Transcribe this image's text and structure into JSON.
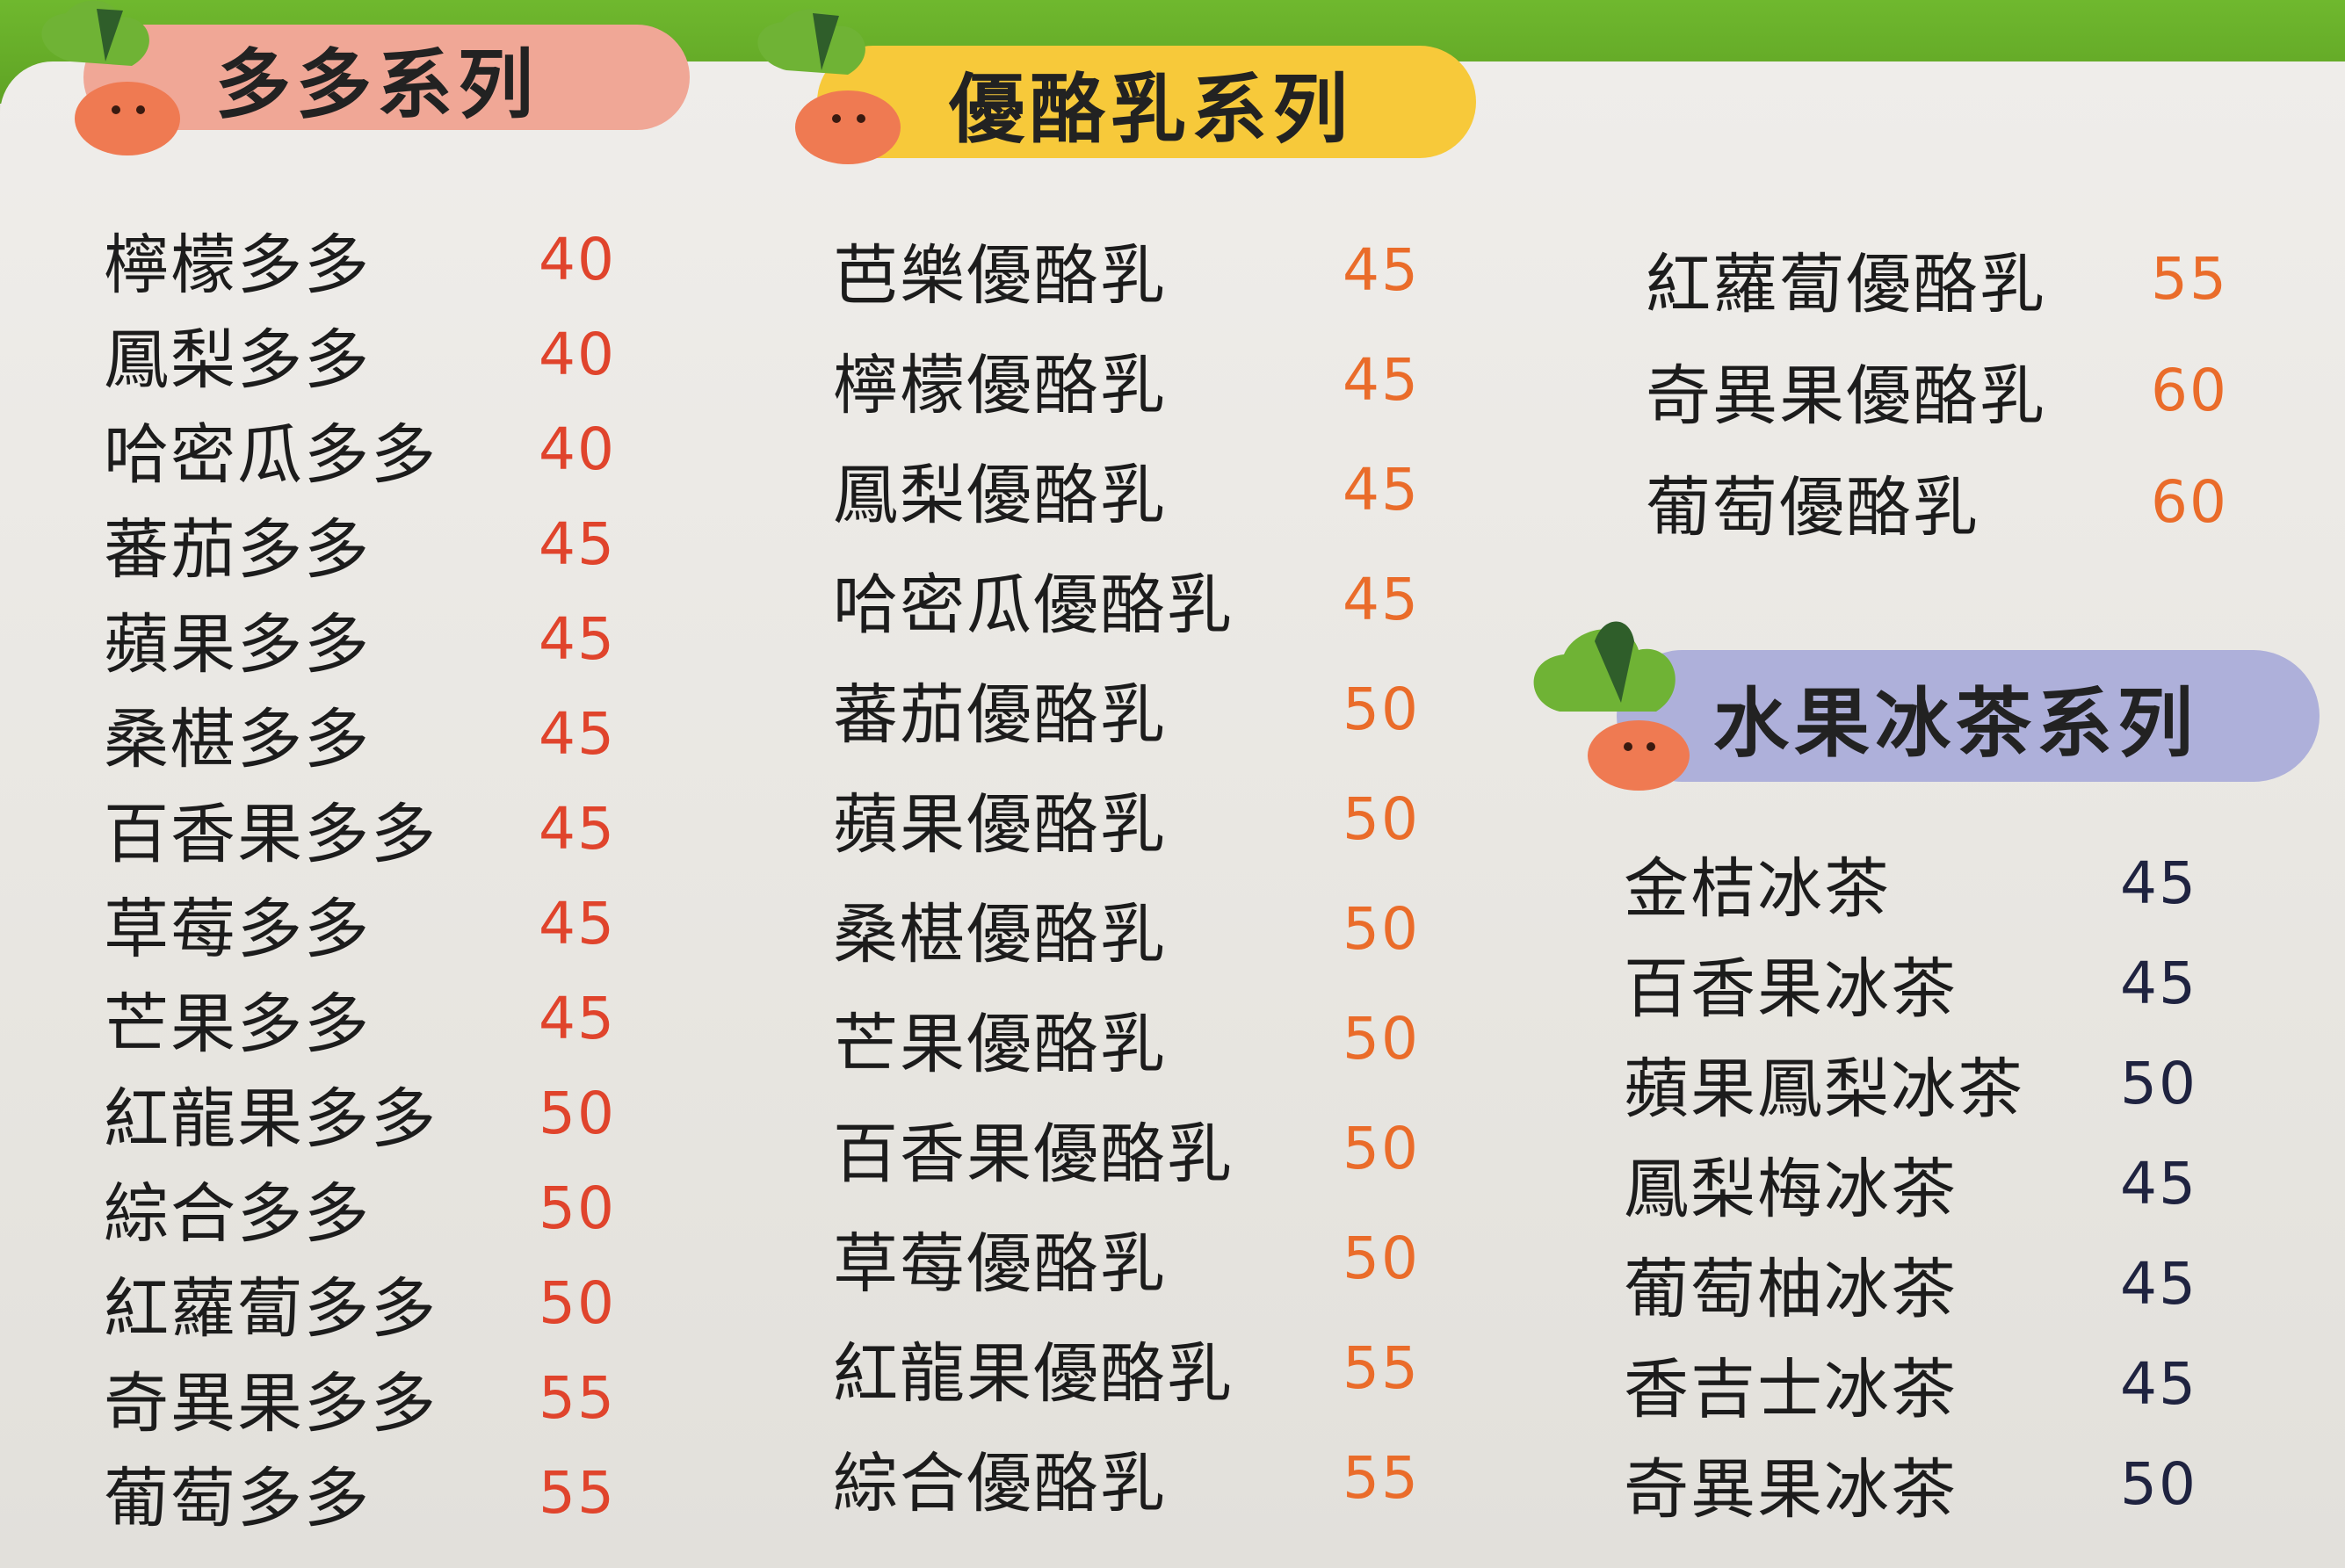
{
  "colors": {
    "green_band": "#66ad28",
    "duoduo_banner": "#f0a796",
    "yogurt_banner": "#f7c93a",
    "tea_banner": "#aeb0da",
    "price_red": "#e0442c",
    "price_orange": "#ea6c2a",
    "price_dark": "#1f2340",
    "mascot_leaf": "#6fb335",
    "mascot_body": "#ef7a52"
  },
  "sections": {
    "duoduo": {
      "title": "多多系列",
      "items": [
        {
          "name": "檸檬多多",
          "price": "40"
        },
        {
          "name": "鳳梨多多",
          "price": "40"
        },
        {
          "name": "哈密瓜多多",
          "price": "40"
        },
        {
          "name": "蕃茄多多",
          "price": "45"
        },
        {
          "name": "蘋果多多",
          "price": "45"
        },
        {
          "name": "桑椹多多",
          "price": "45"
        },
        {
          "name": "百香果多多",
          "price": "45"
        },
        {
          "name": "草莓多多",
          "price": "45"
        },
        {
          "name": "芒果多多",
          "price": "45"
        },
        {
          "name": "紅龍果多多",
          "price": "50"
        },
        {
          "name": "綜合多多",
          "price": "50"
        },
        {
          "name": "紅蘿蔔多多",
          "price": "50"
        },
        {
          "name": "奇異果多多",
          "price": "55"
        },
        {
          "name": "葡萄多多",
          "price": "55"
        }
      ]
    },
    "yogurt": {
      "title": "優酪乳系列",
      "items": [
        {
          "name": "芭樂優酪乳",
          "price": "45"
        },
        {
          "name": "檸檬優酪乳",
          "price": "45"
        },
        {
          "name": "鳳梨優酪乳",
          "price": "45"
        },
        {
          "name": "哈密瓜優酪乳",
          "price": "45"
        },
        {
          "name": "蕃茄優酪乳",
          "price": "50"
        },
        {
          "name": "蘋果優酪乳",
          "price": "50"
        },
        {
          "name": "桑椹優酪乳",
          "price": "50"
        },
        {
          "name": "芒果優酪乳",
          "price": "50"
        },
        {
          "name": "百香果優酪乳",
          "price": "50"
        },
        {
          "name": "草莓優酪乳",
          "price": "50"
        },
        {
          "name": "紅龍果優酪乳",
          "price": "55"
        },
        {
          "name": "綜合優酪乳",
          "price": "55"
        }
      ],
      "extra_items": [
        {
          "name": "紅蘿蔔優酪乳",
          "price": "55"
        },
        {
          "name": "奇異果優酪乳",
          "price": "60"
        },
        {
          "name": "葡萄優酪乳",
          "price": "60"
        }
      ]
    },
    "tea": {
      "title": "水果冰茶系列",
      "items": [
        {
          "name": "金桔冰茶",
          "price": "45"
        },
        {
          "name": "百香果冰茶",
          "price": "45"
        },
        {
          "name": "蘋果鳳梨冰茶",
          "price": "50"
        },
        {
          "name": "鳳梨梅冰茶",
          "price": "45"
        },
        {
          "name": "葡萄柚冰茶",
          "price": "45"
        },
        {
          "name": "香吉士冰茶",
          "price": "45"
        },
        {
          "name": "奇異果冰茶",
          "price": "50"
        }
      ]
    }
  }
}
